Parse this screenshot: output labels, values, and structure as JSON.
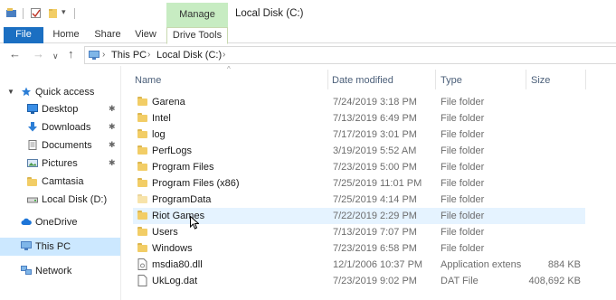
{
  "window": {
    "title": "Local Disk (C:)",
    "manage_label": "Manage",
    "quick_access_dropdown": "▾"
  },
  "ribbon": {
    "tabs": [
      "File",
      "Home",
      "Share",
      "View",
      "Drive Tools"
    ]
  },
  "navigation": {
    "back": "←",
    "forward": "→",
    "recent": "∨",
    "up": "↑",
    "breadcrumb": [
      "This PC",
      "Local Disk (C:)"
    ],
    "breadcrumb_sep": "›"
  },
  "sidebar": {
    "items": [
      {
        "label": "Quick access",
        "icon": "star-icon",
        "pinned": false
      },
      {
        "label": "Desktop",
        "icon": "desktop-icon",
        "pinned": true
      },
      {
        "label": "Downloads",
        "icon": "download-arrow-icon",
        "pinned": true
      },
      {
        "label": "Documents",
        "icon": "documents-icon",
        "pinned": true
      },
      {
        "label": "Pictures",
        "icon": "pictures-icon",
        "pinned": true
      },
      {
        "label": "Camtasia",
        "icon": "folder-icon",
        "pinned": false
      },
      {
        "label": "Local Disk (D:)",
        "icon": "drive-icon",
        "pinned": false
      },
      {
        "label": "OneDrive",
        "icon": "cloud-icon",
        "pinned": false
      },
      {
        "label": "This PC",
        "icon": "computer-icon",
        "pinned": false,
        "selected": true
      },
      {
        "label": "Network",
        "icon": "network-icon",
        "pinned": false
      }
    ],
    "pin_glyph": "📌"
  },
  "columns": {
    "name": "Name",
    "date": "Date modified",
    "type": "Type",
    "size": "Size",
    "sort_arrow": "^"
  },
  "files": [
    {
      "name": "Garena",
      "date": "7/24/2019 3:18 PM",
      "type": "File folder",
      "size": "",
      "icon": "folder-icon"
    },
    {
      "name": "Intel",
      "date": "7/13/2019 6:49 PM",
      "type": "File folder",
      "size": "",
      "icon": "folder-icon"
    },
    {
      "name": "log",
      "date": "7/17/2019 3:01 PM",
      "type": "File folder",
      "size": "",
      "icon": "folder-icon"
    },
    {
      "name": "PerfLogs",
      "date": "3/19/2019 5:52 AM",
      "type": "File folder",
      "size": "",
      "icon": "folder-icon"
    },
    {
      "name": "Program Files",
      "date": "7/23/2019 5:00 PM",
      "type": "File folder",
      "size": "",
      "icon": "folder-icon"
    },
    {
      "name": "Program Files (x86)",
      "date": "7/25/2019 11:01 PM",
      "type": "File folder",
      "size": "",
      "icon": "folder-icon"
    },
    {
      "name": "ProgramData",
      "date": "7/25/2019 4:14 PM",
      "type": "File folder",
      "size": "",
      "icon": "folder-icon"
    },
    {
      "name": "Riot Games",
      "date": "7/22/2019 2:29 PM",
      "type": "File folder",
      "size": "",
      "icon": "folder-icon"
    },
    {
      "name": "Users",
      "date": "7/13/2019 7:07 PM",
      "type": "File folder",
      "size": "",
      "icon": "folder-icon"
    },
    {
      "name": "Windows",
      "date": "7/23/2019 6:58 PM",
      "type": "File folder",
      "size": "",
      "icon": "folder-icon"
    },
    {
      "name": "msdia80.dll",
      "date": "12/1/2006 10:37 PM",
      "type": "Application extens...",
      "size": "884 KB",
      "icon": "dll-file-icon"
    },
    {
      "name": "UkLog.dat",
      "date": "7/23/2019 9:02 PM",
      "type": "DAT File",
      "size": "408,692 KB",
      "icon": "dat-file-icon"
    }
  ],
  "colors": {
    "file_tab": "#1b6fc2",
    "manage_tab": "#c7ecc2",
    "selected_nav": "#cce8ff",
    "hover_row": "#e5f3ff",
    "folder": "#f2cd66"
  }
}
